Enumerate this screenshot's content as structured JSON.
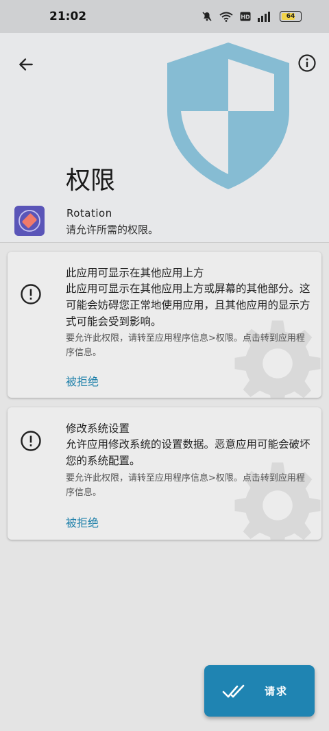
{
  "status_bar": {
    "time": "21:02",
    "battery": "64",
    "icons": [
      "mute-icon",
      "wifi-icon",
      "hd-icon",
      "signal-icon",
      "battery-icon"
    ]
  },
  "header": {
    "title": "权限",
    "app_name": "Rotation",
    "app_subtitle": "请允许所需的权限。"
  },
  "permissions": [
    {
      "title": "此应用可显示在其他应用上方",
      "description": "此应用可显示在其他应用上方或屏幕的其他部分。这可能会妨碍您正常地使用应用，且其他应用的显示方式可能会受到影响。",
      "hint": "要允许此权限，请转至应用程序信息>权限。点击转到应用程序信息。",
      "status": "被拒绝"
    },
    {
      "title": "修改系统设置",
      "description": "允许应用修改系统的设置数据。恶意应用可能会破坏您的系统配置。",
      "hint": "要允许此权限，请转至应用程序信息>权限。点击转到应用程序信息。",
      "status": "被拒绝"
    }
  ],
  "fab": {
    "label": "请求"
  },
  "colors": {
    "accent": "#1f84b2",
    "shield": "#86bcd3",
    "app_icon_bg": "#5a55b8",
    "app_icon_fg": "#f07a6a",
    "denied_text": "#1c7fa9"
  }
}
